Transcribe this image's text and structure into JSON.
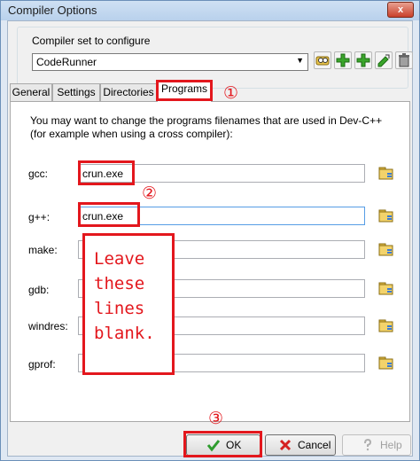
{
  "window": {
    "title": "Compiler Options",
    "close_glyph": "x"
  },
  "compiler_set": {
    "label": "Compiler set to configure",
    "selected": "CodeRunner",
    "toolbar_icons": [
      "find-icon",
      "add-icon",
      "add-icon",
      "rename-icon",
      "delete-icon"
    ]
  },
  "tabs": [
    {
      "label": "General"
    },
    {
      "label": "Settings"
    },
    {
      "label": "Directories"
    },
    {
      "label": "Programs"
    }
  ],
  "programs": {
    "description": "You may want to change the programs filenames that are used in Dev-C++ (for example when using a cross compiler):",
    "rows": [
      {
        "label": "gcc:",
        "value": "crun.exe"
      },
      {
        "label": "g++:",
        "value": "crun.exe"
      },
      {
        "label": "make:",
        "value": ""
      },
      {
        "label": "gdb:",
        "value": ""
      },
      {
        "label": "windres:",
        "value": ""
      },
      {
        "label": "gprof:",
        "value": ""
      }
    ]
  },
  "annotations": {
    "step1": "①",
    "step2": "②",
    "step3": "③",
    "note": "Leave\nthese\nlines\nblank.",
    "color": "#e3171d"
  },
  "buttons": {
    "ok": "OK",
    "cancel": "Cancel",
    "help": "Help"
  }
}
